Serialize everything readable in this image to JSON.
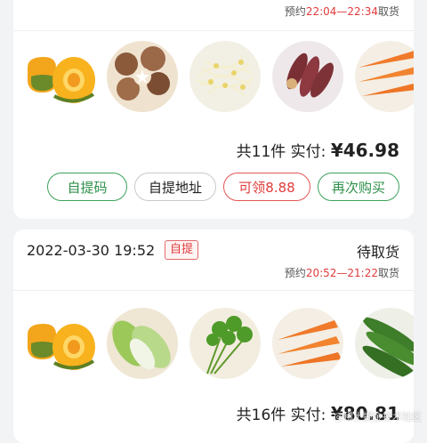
{
  "orders": [
    {
      "pickup_prefix": "预约",
      "pickup_time": "22:04—22:34",
      "pickup_suffix": "取货",
      "products": [
        "pumpkin-icon",
        "shiitake-mushroom-icon",
        "bean-sprouts-icon",
        "sweet-potato-icon",
        "carrot-icon"
      ],
      "total_label": "共11件 实付: ",
      "total_amount": "¥46.98",
      "buttons": [
        "自提码",
        "自提地址",
        "可领8.88",
        "再次购买"
      ]
    },
    {
      "order_time": "2022-03-30 19:52",
      "tag": "自提",
      "status": "待取货",
      "pickup_prefix": "预约",
      "pickup_time": "20:52—21:22",
      "pickup_suffix": "取货",
      "products": [
        "pumpkin-icon",
        "chinese-cabbage-icon",
        "cilantro-icon",
        "carrot-icon",
        "cucumber-icon"
      ],
      "total_label": "共16件 实付: ",
      "total_amount": "¥80.81"
    }
  ],
  "watermark": "@稀土掘金技术社区",
  "colors": {
    "accent_red": "#e03b3b",
    "accent_green": "#3aa15a",
    "background": "#f2f3f5"
  }
}
